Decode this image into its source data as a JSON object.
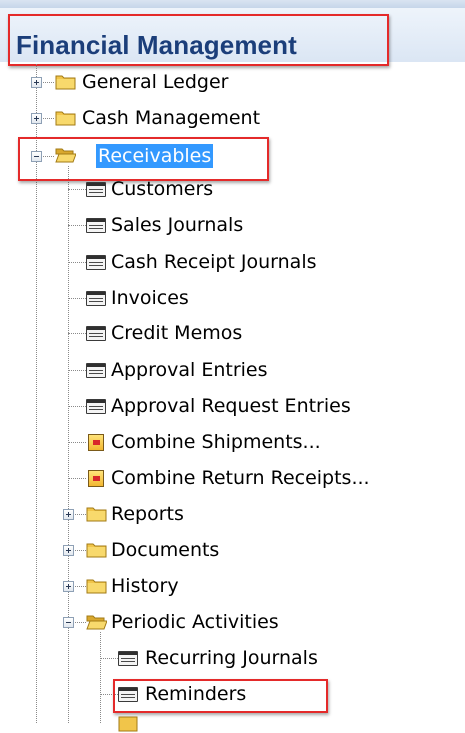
{
  "header": {
    "title": "Financial Management"
  },
  "tree": {
    "general_ledger": "General Ledger",
    "cash_management": "Cash Management",
    "receivables": "Receivables",
    "customers": "Customers",
    "sales_journals": "Sales Journals",
    "cash_receipt_journals": "Cash Receipt Journals",
    "invoices": "Invoices",
    "credit_memos": "Credit Memos",
    "approval_entries": "Approval Entries",
    "approval_request_entries": "Approval Request Entries",
    "combine_shipments": "Combine Shipments...",
    "combine_return_receipts": "Combine Return Receipts...",
    "reports": "Reports",
    "documents": "Documents",
    "history": "History",
    "periodic_activities": "Periodic Activities",
    "recurring_journals": "Recurring Journals",
    "reminders": "Reminders"
  },
  "colors": {
    "title_text": "#1b3e7a",
    "selection": "#3399ff",
    "highlight_box": "#e42a2a"
  }
}
